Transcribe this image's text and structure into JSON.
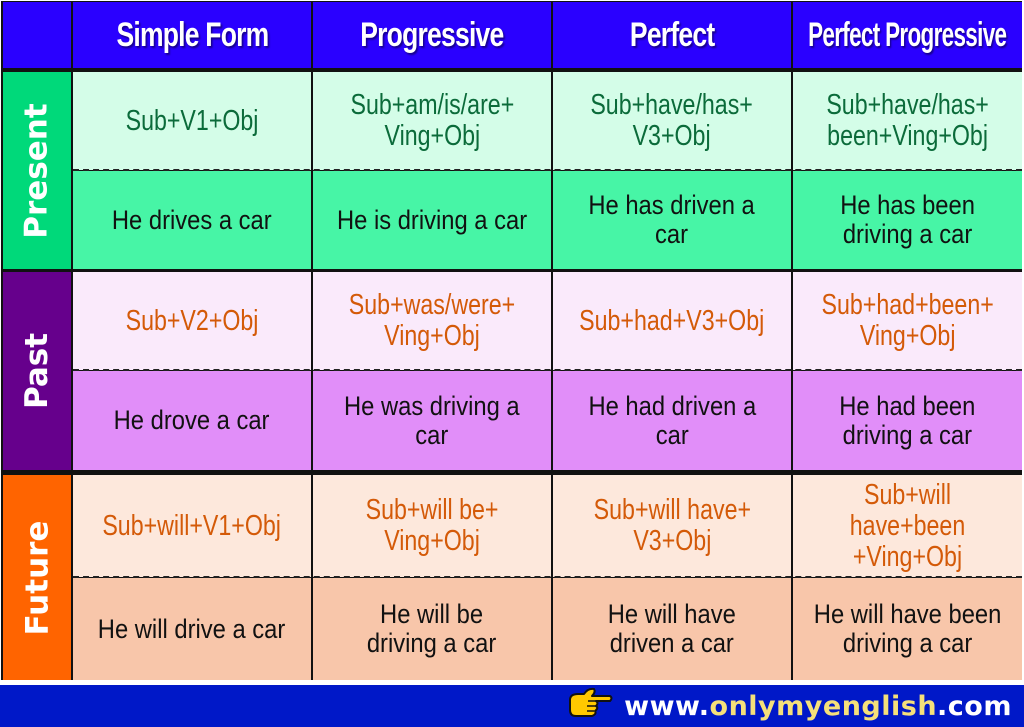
{
  "headers": {
    "corner": "",
    "columns": [
      "Simple Form",
      "Progressive",
      "Perfect",
      "Perfect Progressive"
    ]
  },
  "tenses": [
    {
      "label": "Present",
      "label_color": "#00d97a",
      "formula_bg": "#d4fde8",
      "example_bg": "#47f5a6",
      "formula_color": "#0b6b3a",
      "formulas": [
        "Sub+V1+Obj",
        "Sub+am/is/are+\nVing+Obj",
        "Sub+have/has+\nV3+Obj",
        "Sub+have/has+\nbeen+Ving+Obj"
      ],
      "examples": [
        "He drives a car",
        "He is driving a car",
        "He has driven a\ncar",
        "He has been\ndriving a car"
      ]
    },
    {
      "label": "Past",
      "label_color": "#66008c",
      "formula_bg": "#faeafb",
      "example_bg": "#e18ef9",
      "formula_color": "#d45a08",
      "formulas": [
        "Sub+V2+Obj",
        "Sub+was/were+\nVing+Obj",
        "Sub+had+V3+Obj",
        "Sub+had+been+\nVing+Obj"
      ],
      "examples": [
        "He drove a car",
        "He was driving a\ncar",
        "He had driven a\ncar",
        "He had been\ndriving a car"
      ]
    },
    {
      "label": "Future",
      "label_color": "#ff6400",
      "formula_bg": "#fde8dc",
      "example_bg": "#f8c6aa",
      "formula_color": "#d45a08",
      "formulas": [
        "Sub+will+V1+Obj",
        "Sub+will be+\nVing+Obj",
        "Sub+will have+\nV3+Obj",
        "Sub+will have+been\n+Ving+Obj"
      ],
      "examples": [
        "He will drive a car",
        "He will be\ndriving a car",
        "He will have\ndriven a car",
        "He will have been\ndriving a car"
      ]
    }
  ],
  "footer": {
    "icon": "pointing-hand-icon",
    "url_prefix": "www.",
    "url_main": "onlymyenglish",
    "url_suffix": ".com"
  }
}
